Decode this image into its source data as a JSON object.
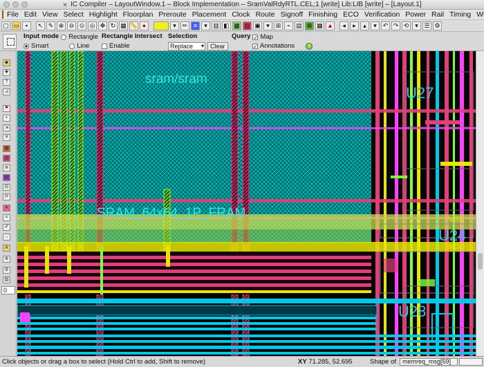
{
  "window": {
    "title": "IC Compiler – LayoutWindow.1 – Block Implementation – SramValRdyRTL.CEL;1 [write]   Lib:LIB [write] – [Layout.1]"
  },
  "menu": [
    "File",
    "Edit",
    "View",
    "Select",
    "Highlight",
    "Floorplan",
    "Preroute",
    "Placement",
    "Clock",
    "Route",
    "Signoff",
    "Finishing",
    "ECO",
    "Verification",
    "Power",
    "Rail",
    "Timing",
    "Window"
  ],
  "options": {
    "input_mode": {
      "label": "Input mode",
      "rectangle": "Rectangle",
      "smart": "Smart",
      "line": "Line",
      "selected": "smart"
    },
    "rect_intersect": {
      "label": "Rectangle Intersect",
      "enable": "Enable",
      "enabled": false
    },
    "selection": {
      "label": "Selection",
      "value": "Replace",
      "clear": "Clear"
    },
    "query": {
      "label": "Query",
      "map": "Map",
      "annotations": "Annotations",
      "map_checked": true,
      "annotations_checked": true
    }
  },
  "zoom_field": "0",
  "layout": {
    "labels": {
      "sram_top": "sram/sram",
      "sram_cell": "SRAM_64x64_1P_FRAM",
      "u27": "U27",
      "u24": "U24",
      "u28": "U28",
      "vss": "VSS",
      "vdd": "VDD"
    },
    "colors": {
      "background": "#000000",
      "macro_fill": "#006a6a",
      "macro_hatch": "#00c8c8",
      "metal_pink": "#e0407a",
      "metal_green": "#7cff3a",
      "metal_yellow": "#e6e600",
      "metal_cyan": "#00c8e6",
      "metal_magenta": "#ff40ff",
      "label_cyan": "#33e6e6"
    }
  },
  "status": {
    "message": "Click objects or drag a box to select (Hold Ctrl to add, Shift to remove)",
    "xy_label": "XY",
    "xy_value": "71.285, 52.695",
    "shape_label": "Shape of",
    "shape_value": "memreq_msg[59]"
  }
}
